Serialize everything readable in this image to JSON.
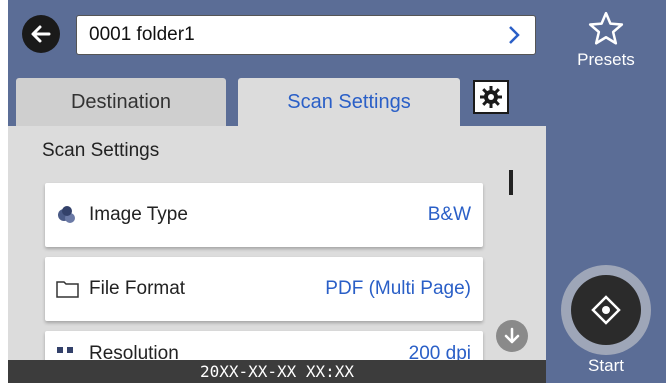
{
  "header": {
    "folder_value": "0001 folder1"
  },
  "tabs": [
    {
      "label": "Destination",
      "active": false
    },
    {
      "label": "Scan Settings",
      "active": true
    }
  ],
  "section_title": "Scan Settings",
  "settings": [
    {
      "label": "Image Type",
      "value": "B&W",
      "icon": "image-type-icon"
    },
    {
      "label": "File Format",
      "value": "PDF (Multi Page)",
      "icon": "folder-icon"
    },
    {
      "label": "Resolution",
      "value": "200 dpi",
      "icon": "resolution-icon"
    }
  ],
  "status": {
    "datetime": "20XX-XX-XX XX:XX"
  },
  "right_panel": {
    "presets_label": "Presets",
    "start_label": "Start"
  },
  "colors": {
    "accent_blue": "#2a5fc7",
    "panel": "#5b6d96",
    "background": "#dcdcdc"
  }
}
